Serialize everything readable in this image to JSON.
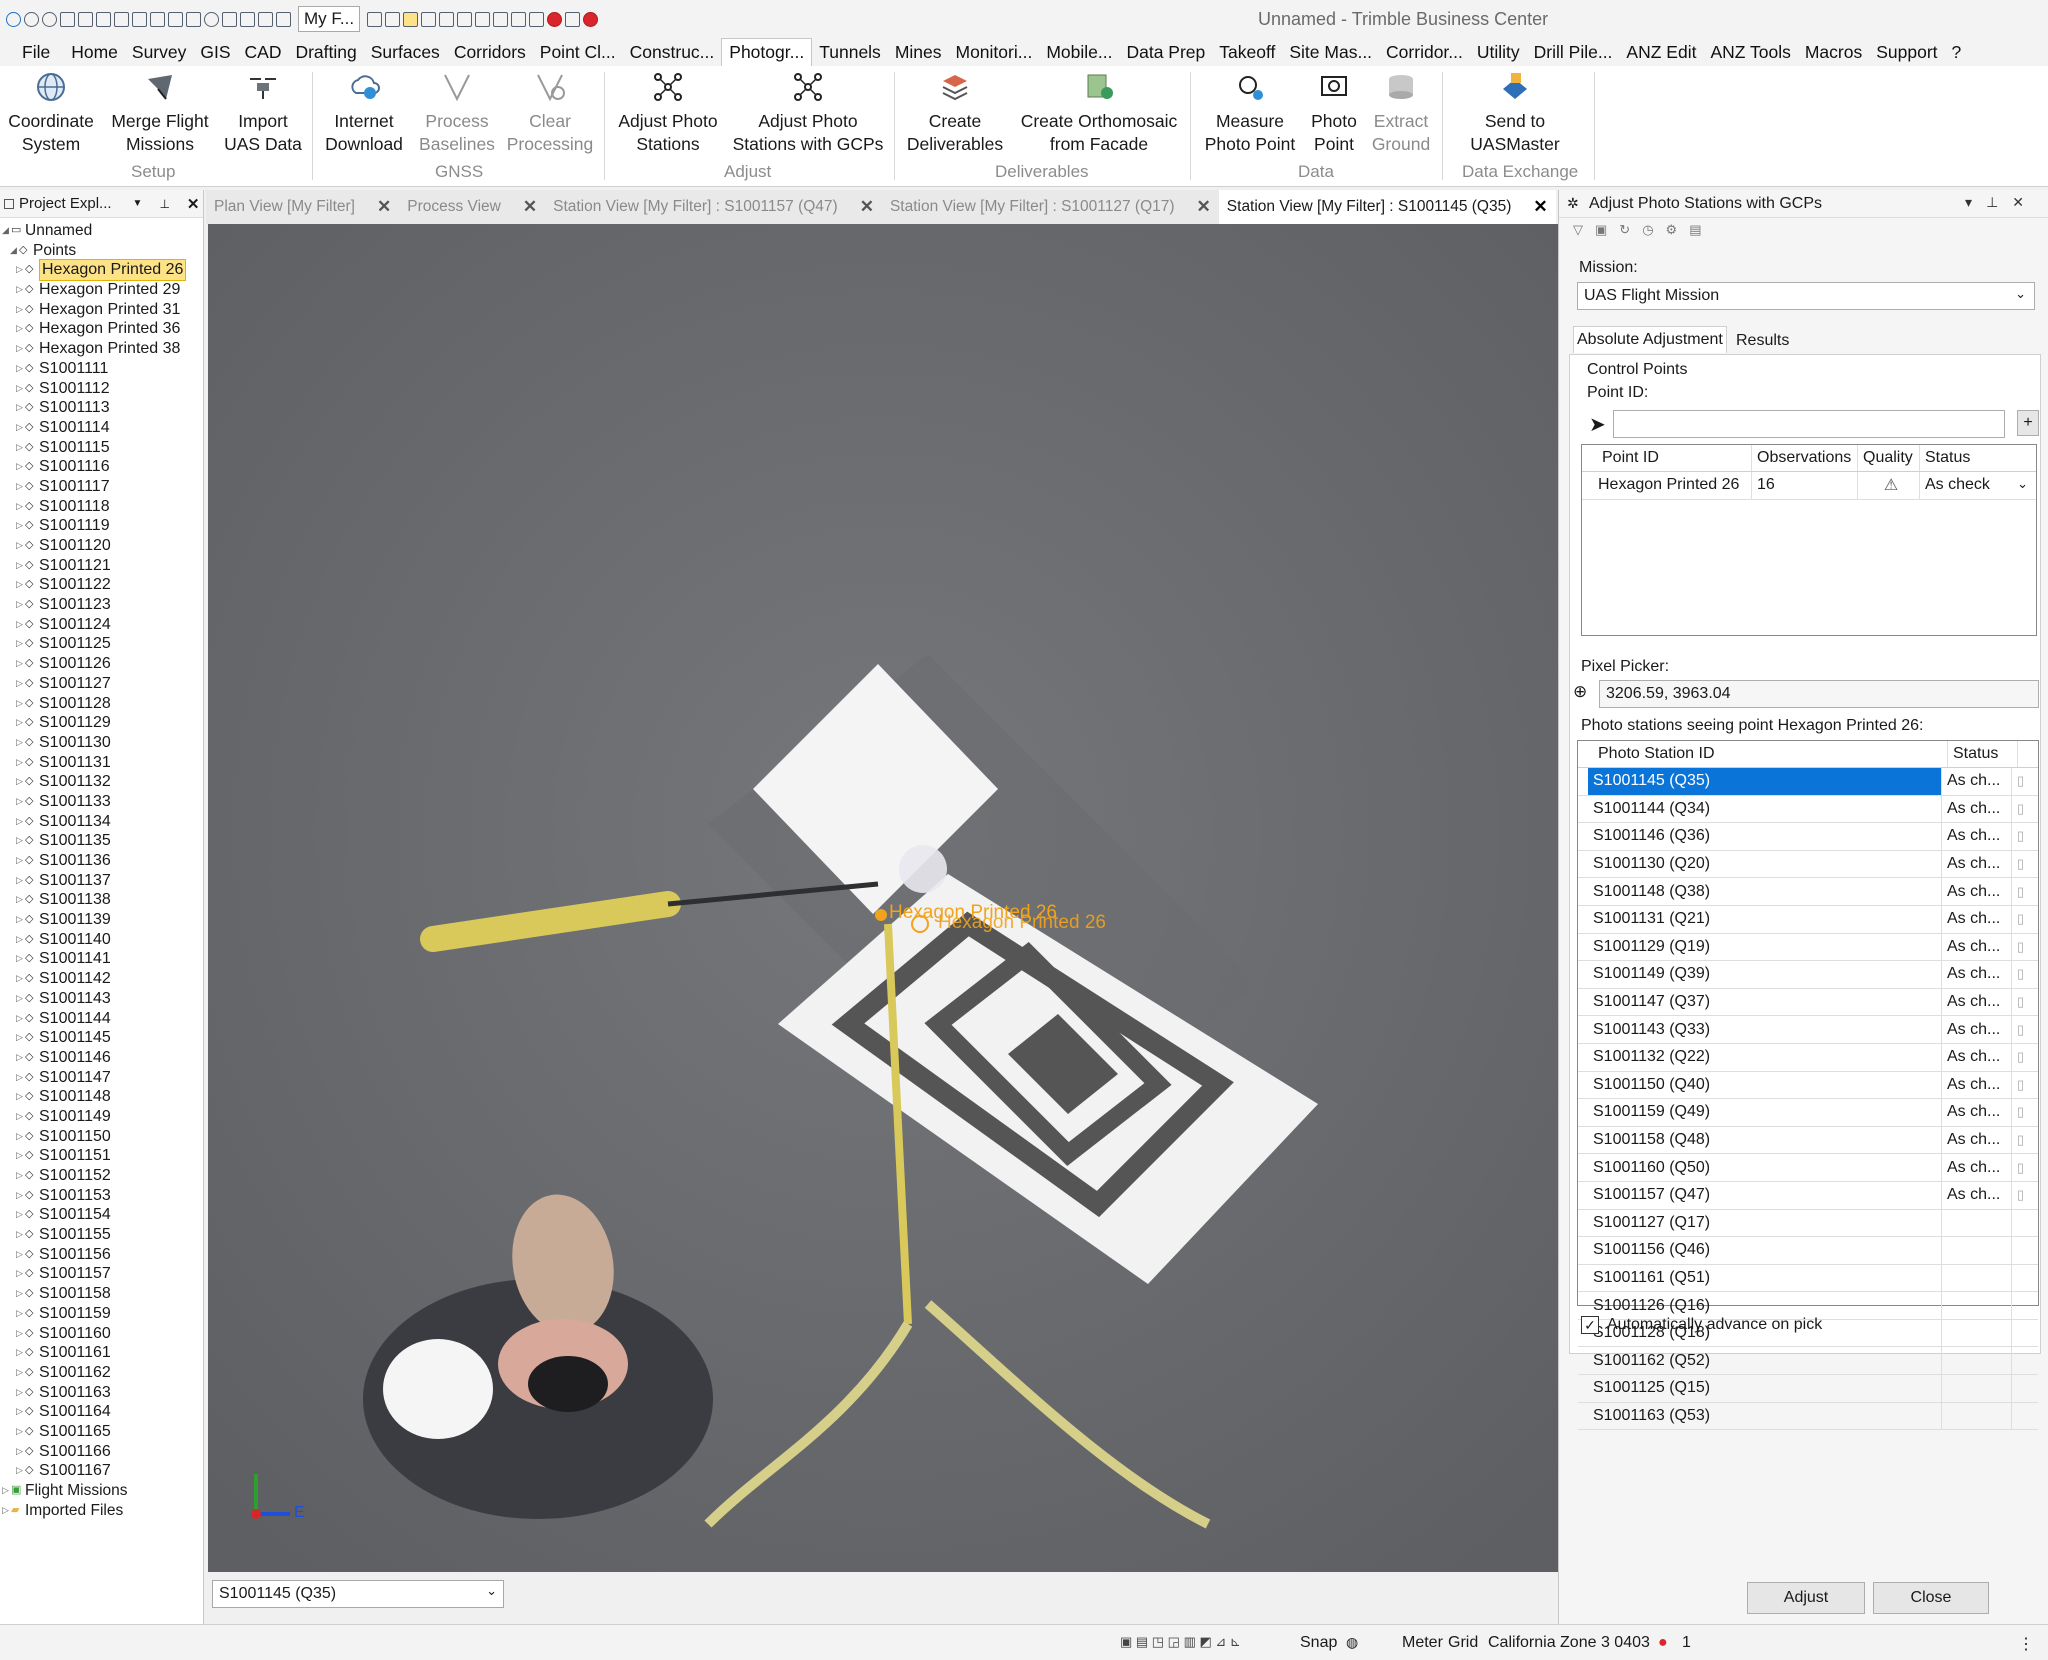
{
  "window": {
    "title": "Unnamed - Trimble Business Center",
    "filter_combo": "My F..."
  },
  "menu": [
    "Home",
    "Survey",
    "GIS",
    "CAD",
    "Drafting",
    "Surfaces",
    "Corridors",
    "Point Cl...",
    "Construc...",
    "Photogr...",
    "Tunnels",
    "Mines",
    "Monitori...",
    "Mobile...",
    "Data Prep",
    "Takeoff",
    "Site Mas...",
    "Corridor...",
    "Utility",
    "Drill Pile...",
    "ANZ Edit",
    "ANZ Tools",
    "Macros",
    "Support"
  ],
  "menu_file": "File",
  "menu_help": "?",
  "ribbon": {
    "coord_system": [
      "Coordinate",
      "System"
    ],
    "merge_flight": [
      "Merge Flight",
      "Missions"
    ],
    "import_uas": [
      "Import",
      "UAS Data"
    ],
    "internet_download": [
      "Internet",
      "Download"
    ],
    "process_baselines": [
      "Process",
      "Baselines"
    ],
    "clear_processing": [
      "Clear",
      "Processing"
    ],
    "adjust_photo": [
      "Adjust Photo",
      "Stations"
    ],
    "adjust_photo_gcps": [
      "Adjust Photo",
      "Stations with GCPs"
    ],
    "create_deliverables": [
      "Create",
      "Deliverables"
    ],
    "create_ortho": [
      "Create Orthomosaic",
      "from Facade"
    ],
    "measure_photo": [
      "Measure",
      "Photo Point"
    ],
    "photo_point": [
      "Photo",
      "Point"
    ],
    "extract_ground": [
      "Extract",
      "Ground"
    ],
    "send_uasmaster": [
      "Send to",
      "UASMaster"
    ],
    "groups": {
      "setup": "Setup",
      "gnss": "GNSS",
      "adjust": "Adjust",
      "deliverables": "Deliverables",
      "data": "Data",
      "data_exchange": "Data Exchange"
    }
  },
  "project_explorer": {
    "title": "Project Expl...",
    "root": "Unnamed",
    "points_label": "Points",
    "points": [
      "Hexagon Printed 26",
      "Hexagon Printed 29",
      "Hexagon Printed 31",
      "Hexagon Printed 36",
      "Hexagon Printed 38",
      "S1001111",
      "S1001112",
      "S1001113",
      "S1001114",
      "S1001115",
      "S1001116",
      "S1001117",
      "S1001118",
      "S1001119",
      "S1001120",
      "S1001121",
      "S1001122",
      "S1001123",
      "S1001124",
      "S1001125",
      "S1001126",
      "S1001127",
      "S1001128",
      "S1001129",
      "S1001130",
      "S1001131",
      "S1001132",
      "S1001133",
      "S1001134",
      "S1001135",
      "S1001136",
      "S1001137",
      "S1001138",
      "S1001139",
      "S1001140",
      "S1001141",
      "S1001142",
      "S1001143",
      "S1001144",
      "S1001145",
      "S1001146",
      "S1001147",
      "S1001148",
      "S1001149",
      "S1001150",
      "S1001151",
      "S1001152",
      "S1001153",
      "S1001154",
      "S1001155",
      "S1001156",
      "S1001157",
      "S1001158",
      "S1001159",
      "S1001160",
      "S1001161",
      "S1001162",
      "S1001163",
      "S1001164",
      "S1001165",
      "S1001166",
      "S1001167"
    ],
    "flight_missions": "Flight Missions",
    "imported_files": "Imported Files"
  },
  "view_tabs": [
    "Plan View [My Filter]",
    "Process View",
    "Station View [My Filter] : S1001157 (Q47)",
    "Station View [My Filter] : S1001127 (Q17)",
    "Station View [My Filter] : S1001145 (Q35)"
  ],
  "station_view": {
    "gcp_label_1": "Hexagon Printed 26",
    "gcp_label_2": "Hexagon Printed 26",
    "axis_east": "E",
    "station_selector": "S1001145 (Q35)"
  },
  "adjust_panel": {
    "title": "Adjust Photo Stations with GCPs",
    "mission_label": "Mission:",
    "mission_value": "UAS Flight Mission",
    "tab_absolute": "Absolute Adjustment",
    "tab_results": "Results",
    "control_points_label": "Control Points",
    "point_id_label": "Point ID:",
    "point_id_value": "",
    "add_button": "+",
    "cp_headers": [
      "Point ID",
      "Observations",
      "Quality",
      "Status"
    ],
    "cp_rows": [
      {
        "id": "Hexagon Printed 26",
        "obs": "16",
        "quality": "⚠",
        "status": "As check"
      }
    ],
    "pixel_picker_label": "Pixel Picker:",
    "pixel_picker_value": "3206.59, 3963.04",
    "stations_label": "Photo stations seeing point Hexagon Printed 26:",
    "station_headers": [
      "Photo Station ID",
      "Status"
    ],
    "stations": [
      {
        "id": "S1001145 (Q35)",
        "status": "As ch..."
      },
      {
        "id": "S1001144 (Q34)",
        "status": "As ch..."
      },
      {
        "id": "S1001146 (Q36)",
        "status": "As ch..."
      },
      {
        "id": "S1001130 (Q20)",
        "status": "As ch..."
      },
      {
        "id": "S1001148 (Q38)",
        "status": "As ch..."
      },
      {
        "id": "S1001131 (Q21)",
        "status": "As ch..."
      },
      {
        "id": "S1001129 (Q19)",
        "status": "As ch..."
      },
      {
        "id": "S1001149 (Q39)",
        "status": "As ch..."
      },
      {
        "id": "S1001147 (Q37)",
        "status": "As ch..."
      },
      {
        "id": "S1001143 (Q33)",
        "status": "As ch..."
      },
      {
        "id": "S1001132 (Q22)",
        "status": "As ch..."
      },
      {
        "id": "S1001150 (Q40)",
        "status": "As ch..."
      },
      {
        "id": "S1001159 (Q49)",
        "status": "As ch..."
      },
      {
        "id": "S1001158 (Q48)",
        "status": "As ch..."
      },
      {
        "id": "S1001160 (Q50)",
        "status": "As ch..."
      },
      {
        "id": "S1001157 (Q47)",
        "status": "As ch..."
      },
      {
        "id": "S1001127 (Q17)",
        "status": ""
      },
      {
        "id": "S1001156 (Q46)",
        "status": ""
      },
      {
        "id": "S1001161 (Q51)",
        "status": ""
      },
      {
        "id": "S1001126 (Q16)",
        "status": ""
      },
      {
        "id": "S1001128 (Q18)",
        "status": ""
      },
      {
        "id": "S1001162 (Q52)",
        "status": ""
      },
      {
        "id": "S1001125 (Q15)",
        "status": ""
      },
      {
        "id": "S1001163 (Q53)",
        "status": ""
      }
    ],
    "auto_advance_label": "Automatically advance on pick",
    "auto_advance_checked": true,
    "adjust_button": "Adjust",
    "close_button": "Close"
  },
  "statusbar": {
    "snap": "Snap",
    "units": "Meter",
    "grid": "Grid",
    "zone": "California Zone 3 0403",
    "count": "1"
  },
  "colors": {
    "accent": "#0a74d8",
    "gcp_label": "#f2a31c",
    "selected_tree": "#fde386"
  }
}
